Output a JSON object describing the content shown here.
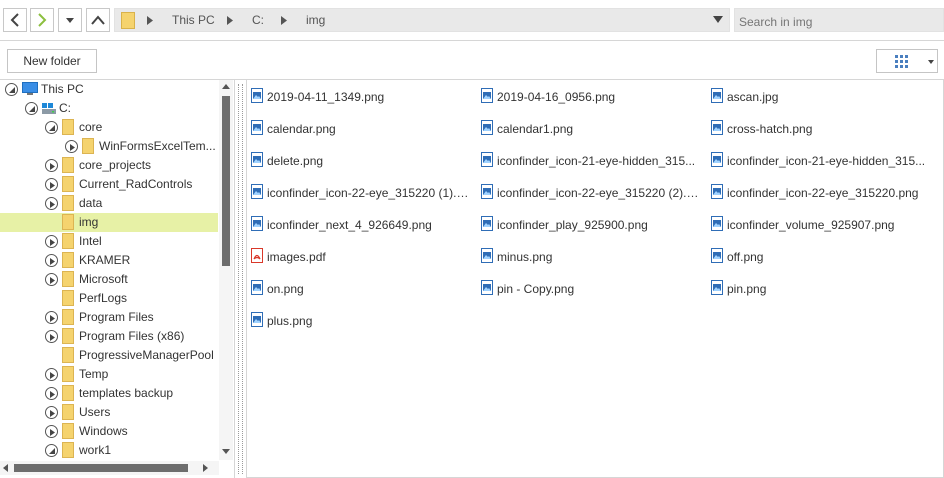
{
  "nav": {
    "breadcrumb": [
      "This PC",
      "C:",
      "img"
    ],
    "search_placeholder": "Search in img"
  },
  "toolbar": {
    "new_folder_label": "New folder"
  },
  "tree": {
    "items": [
      {
        "label": "This PC",
        "level": 0,
        "icon": "computer-icon",
        "expander": "expanded"
      },
      {
        "label": "C:",
        "level": 1,
        "icon": "drive-icon",
        "expander": "expanded"
      },
      {
        "label": "core",
        "level": 2,
        "icon": "folder-icon",
        "expander": "expanded"
      },
      {
        "label": "WinFormsExcelTem...",
        "level": 3,
        "icon": "folder-icon",
        "expander": "collapsed"
      },
      {
        "label": "core_projects",
        "level": 2,
        "icon": "folder-icon",
        "expander": "collapsed"
      },
      {
        "label": "Current_RadControls",
        "level": 2,
        "icon": "folder-icon",
        "expander": "collapsed"
      },
      {
        "label": "data",
        "level": 2,
        "icon": "folder-icon",
        "expander": "collapsed"
      },
      {
        "label": "img",
        "level": 2,
        "icon": "folder-icon",
        "expander": "none",
        "selected": true
      },
      {
        "label": "Intel",
        "level": 2,
        "icon": "folder-icon",
        "expander": "collapsed"
      },
      {
        "label": "KRAMER",
        "level": 2,
        "icon": "folder-icon",
        "expander": "collapsed"
      },
      {
        "label": "Microsoft",
        "level": 2,
        "icon": "folder-icon",
        "expander": "collapsed"
      },
      {
        "label": "PerfLogs",
        "level": 2,
        "icon": "folder-icon",
        "expander": "none"
      },
      {
        "label": "Program Files",
        "level": 2,
        "icon": "folder-icon",
        "expander": "collapsed"
      },
      {
        "label": "Program Files (x86)",
        "level": 2,
        "icon": "folder-icon",
        "expander": "collapsed"
      },
      {
        "label": "ProgressiveManagerPool",
        "level": 2,
        "icon": "folder-icon",
        "expander": "none"
      },
      {
        "label": "Temp",
        "level": 2,
        "icon": "folder-icon",
        "expander": "collapsed"
      },
      {
        "label": "templates backup",
        "level": 2,
        "icon": "folder-icon",
        "expander": "collapsed"
      },
      {
        "label": "Users",
        "level": 2,
        "icon": "folder-icon",
        "expander": "collapsed"
      },
      {
        "label": "Windows",
        "level": 2,
        "icon": "folder-icon",
        "expander": "collapsed"
      },
      {
        "label": "work1",
        "level": 2,
        "icon": "folder-icon",
        "expander": "expanded"
      }
    ]
  },
  "files": [
    {
      "name": "2019-04-11_1349.png",
      "icon": "image-file-icon"
    },
    {
      "name": "2019-04-16_0956.png",
      "icon": "image-file-icon"
    },
    {
      "name": "ascan.jpg",
      "icon": "image-file-icon"
    },
    {
      "name": "calendar.png",
      "icon": "image-file-icon"
    },
    {
      "name": "calendar1.png",
      "icon": "image-file-icon"
    },
    {
      "name": "cross-hatch.png",
      "icon": "image-file-icon"
    },
    {
      "name": "delete.png",
      "icon": "image-file-icon"
    },
    {
      "name": "iconfinder_icon-21-eye-hidden_315...",
      "icon": "image-file-icon"
    },
    {
      "name": "iconfinder_icon-21-eye-hidden_315...",
      "icon": "image-file-icon"
    },
    {
      "name": "iconfinder_icon-22-eye_315220 (1).p...",
      "icon": "image-file-icon"
    },
    {
      "name": "iconfinder_icon-22-eye_315220 (2).p...",
      "icon": "image-file-icon"
    },
    {
      "name": "iconfinder_icon-22-eye_315220.png",
      "icon": "image-file-icon"
    },
    {
      "name": "iconfinder_next_4_926649.png",
      "icon": "image-file-icon"
    },
    {
      "name": "iconfinder_play_925900.png",
      "icon": "image-file-icon"
    },
    {
      "name": "iconfinder_volume_925907.png",
      "icon": "image-file-icon"
    },
    {
      "name": "images.pdf",
      "icon": "pdf-file-icon"
    },
    {
      "name": "minus.png",
      "icon": "image-file-icon"
    },
    {
      "name": "off.png",
      "icon": "image-file-icon"
    },
    {
      "name": "on.png",
      "icon": "image-file-icon"
    },
    {
      "name": "pin - Copy.png",
      "icon": "image-file-icon"
    },
    {
      "name": "pin.png",
      "icon": "image-file-icon"
    },
    {
      "name": "plus.png",
      "icon": "image-file-icon"
    }
  ],
  "colors": {
    "selection": "#e7f1a6",
    "folder": "#f5d36e",
    "image_icon": "#2f6db6",
    "pdf_icon": "#d9382a",
    "forward_arrow": "#8cbf3f"
  }
}
